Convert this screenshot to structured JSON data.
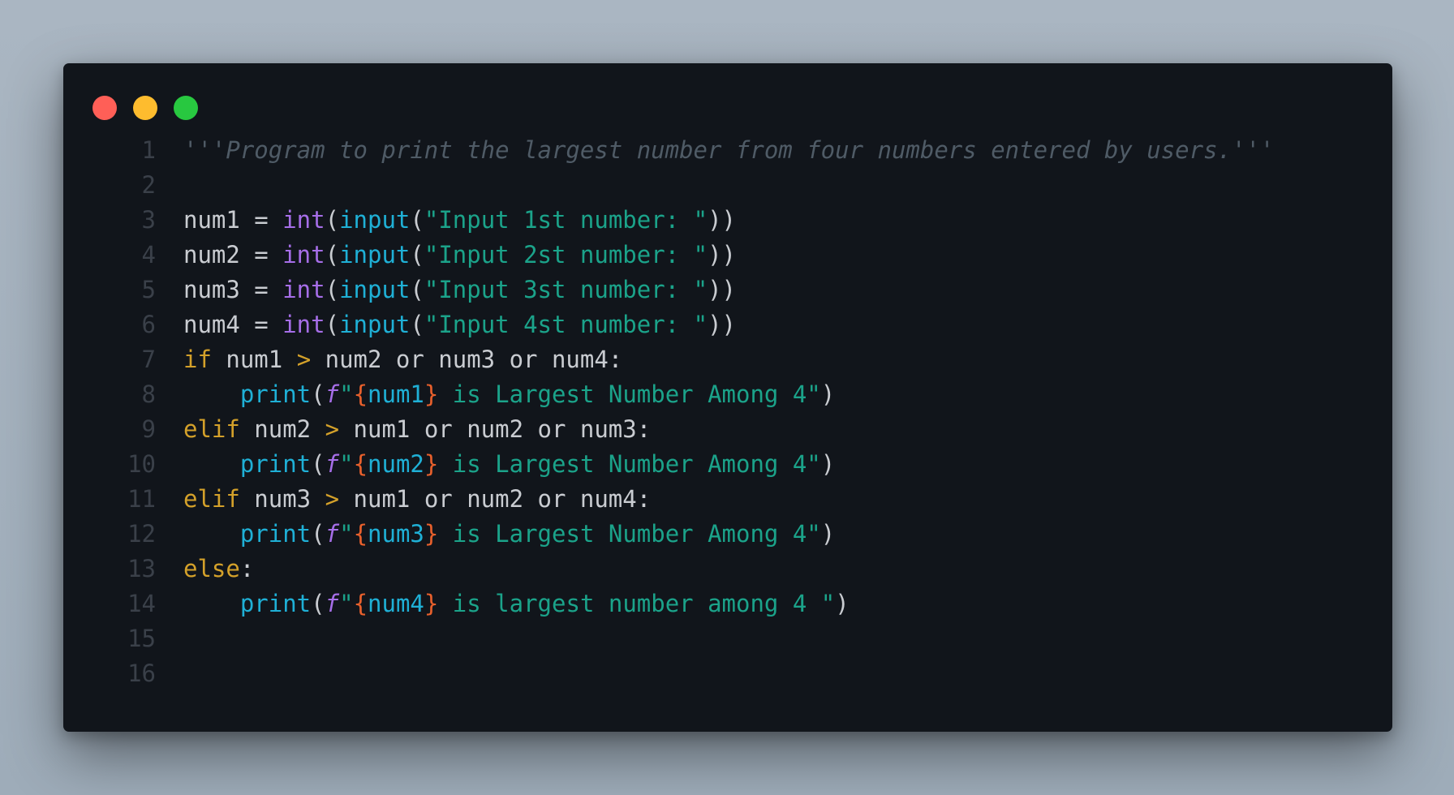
{
  "window": {
    "traffic_lights": [
      {
        "name": "close",
        "color": "#ff5f57"
      },
      {
        "name": "minimize",
        "color": "#febc2e"
      },
      {
        "name": "zoom",
        "color": "#28c840"
      }
    ]
  },
  "theme": {
    "background": "#11151b",
    "line_number": "#3a4049",
    "plain": "#c9ccd1",
    "builtin_purple": "#a66ee8",
    "function_cyan": "#1fb0d6",
    "string_teal": "#1ba38a",
    "keyword_yellow": "#d4a12a",
    "interp_orange": "#e8602c",
    "comment": "#4f5b66"
  },
  "code": {
    "lines": [
      {
        "n": "1",
        "tokens": [
          {
            "t": "'''Program to print the largest number from four numbers entered by users.'''",
            "k": "comment"
          }
        ]
      },
      {
        "n": "2",
        "tokens": []
      },
      {
        "n": "3",
        "tokens": [
          {
            "t": "num1 = ",
            "k": "plain"
          },
          {
            "t": "int",
            "k": "builtin"
          },
          {
            "t": "(",
            "k": "plain"
          },
          {
            "t": "input",
            "k": "func"
          },
          {
            "t": "(",
            "k": "plain"
          },
          {
            "t": "\"Input 1st number: \"",
            "k": "string"
          },
          {
            "t": "))",
            "k": "plain"
          }
        ]
      },
      {
        "n": "4",
        "tokens": [
          {
            "t": "num2 = ",
            "k": "plain"
          },
          {
            "t": "int",
            "k": "builtin"
          },
          {
            "t": "(",
            "k": "plain"
          },
          {
            "t": "input",
            "k": "func"
          },
          {
            "t": "(",
            "k": "plain"
          },
          {
            "t": "\"Input 2st number: \"",
            "k": "string"
          },
          {
            "t": "))",
            "k": "plain"
          }
        ]
      },
      {
        "n": "5",
        "tokens": [
          {
            "t": "num3 = ",
            "k": "plain"
          },
          {
            "t": "int",
            "k": "builtin"
          },
          {
            "t": "(",
            "k": "plain"
          },
          {
            "t": "input",
            "k": "func"
          },
          {
            "t": "(",
            "k": "plain"
          },
          {
            "t": "\"Input 3st number: \"",
            "k": "string"
          },
          {
            "t": "))",
            "k": "plain"
          }
        ]
      },
      {
        "n": "6",
        "tokens": [
          {
            "t": "num4 = ",
            "k": "plain"
          },
          {
            "t": "int",
            "k": "builtin"
          },
          {
            "t": "(",
            "k": "plain"
          },
          {
            "t": "input",
            "k": "func"
          },
          {
            "t": "(",
            "k": "plain"
          },
          {
            "t": "\"Input 4st number: \"",
            "k": "string"
          },
          {
            "t": "))",
            "k": "plain"
          }
        ]
      },
      {
        "n": "7",
        "tokens": [
          {
            "t": "if",
            "k": "keyword"
          },
          {
            "t": " num1 ",
            "k": "plain"
          },
          {
            "t": ">",
            "k": "keyword"
          },
          {
            "t": " num2 or num3 or num4:",
            "k": "plain"
          }
        ]
      },
      {
        "n": "8",
        "tokens": [
          {
            "t": "    ",
            "k": "plain"
          },
          {
            "t": "print",
            "k": "func"
          },
          {
            "t": "(",
            "k": "plain"
          },
          {
            "t": "f",
            "k": "fprefix"
          },
          {
            "t": "\"",
            "k": "string"
          },
          {
            "t": "{",
            "k": "interp"
          },
          {
            "t": "num1",
            "k": "func"
          },
          {
            "t": "}",
            "k": "interp"
          },
          {
            "t": " is Largest Number Among 4\"",
            "k": "string"
          },
          {
            "t": ")",
            "k": "plain"
          }
        ]
      },
      {
        "n": "9",
        "tokens": [
          {
            "t": "elif",
            "k": "keyword"
          },
          {
            "t": " num2 ",
            "k": "plain"
          },
          {
            "t": ">",
            "k": "keyword"
          },
          {
            "t": " num1 or num2 or num3:",
            "k": "plain"
          }
        ]
      },
      {
        "n": "10",
        "tokens": [
          {
            "t": "    ",
            "k": "plain"
          },
          {
            "t": "print",
            "k": "func"
          },
          {
            "t": "(",
            "k": "plain"
          },
          {
            "t": "f",
            "k": "fprefix"
          },
          {
            "t": "\"",
            "k": "string"
          },
          {
            "t": "{",
            "k": "interp"
          },
          {
            "t": "num2",
            "k": "func"
          },
          {
            "t": "}",
            "k": "interp"
          },
          {
            "t": " is Largest Number Among 4\"",
            "k": "string"
          },
          {
            "t": ")",
            "k": "plain"
          }
        ]
      },
      {
        "n": "11",
        "tokens": [
          {
            "t": "elif",
            "k": "keyword"
          },
          {
            "t": " num3 ",
            "k": "plain"
          },
          {
            "t": ">",
            "k": "keyword"
          },
          {
            "t": " num1 or num2 or num4:",
            "k": "plain"
          }
        ]
      },
      {
        "n": "12",
        "tokens": [
          {
            "t": "    ",
            "k": "plain"
          },
          {
            "t": "print",
            "k": "func"
          },
          {
            "t": "(",
            "k": "plain"
          },
          {
            "t": "f",
            "k": "fprefix"
          },
          {
            "t": "\"",
            "k": "string"
          },
          {
            "t": "{",
            "k": "interp"
          },
          {
            "t": "num3",
            "k": "func"
          },
          {
            "t": "}",
            "k": "interp"
          },
          {
            "t": " is Largest Number Among 4\"",
            "k": "string"
          },
          {
            "t": ")",
            "k": "plain"
          }
        ]
      },
      {
        "n": "13",
        "tokens": [
          {
            "t": "else",
            "k": "keyword"
          },
          {
            "t": ":",
            "k": "plain"
          }
        ]
      },
      {
        "n": "14",
        "tokens": [
          {
            "t": "    ",
            "k": "plain"
          },
          {
            "t": "print",
            "k": "func"
          },
          {
            "t": "(",
            "k": "plain"
          },
          {
            "t": "f",
            "k": "fprefix"
          },
          {
            "t": "\"",
            "k": "string"
          },
          {
            "t": "{",
            "k": "interp"
          },
          {
            "t": "num4",
            "k": "func"
          },
          {
            "t": "}",
            "k": "interp"
          },
          {
            "t": " is largest number among 4 \"",
            "k": "string"
          },
          {
            "t": ")",
            "k": "plain"
          }
        ]
      },
      {
        "n": "15",
        "tokens": []
      },
      {
        "n": "16",
        "tokens": []
      }
    ]
  }
}
